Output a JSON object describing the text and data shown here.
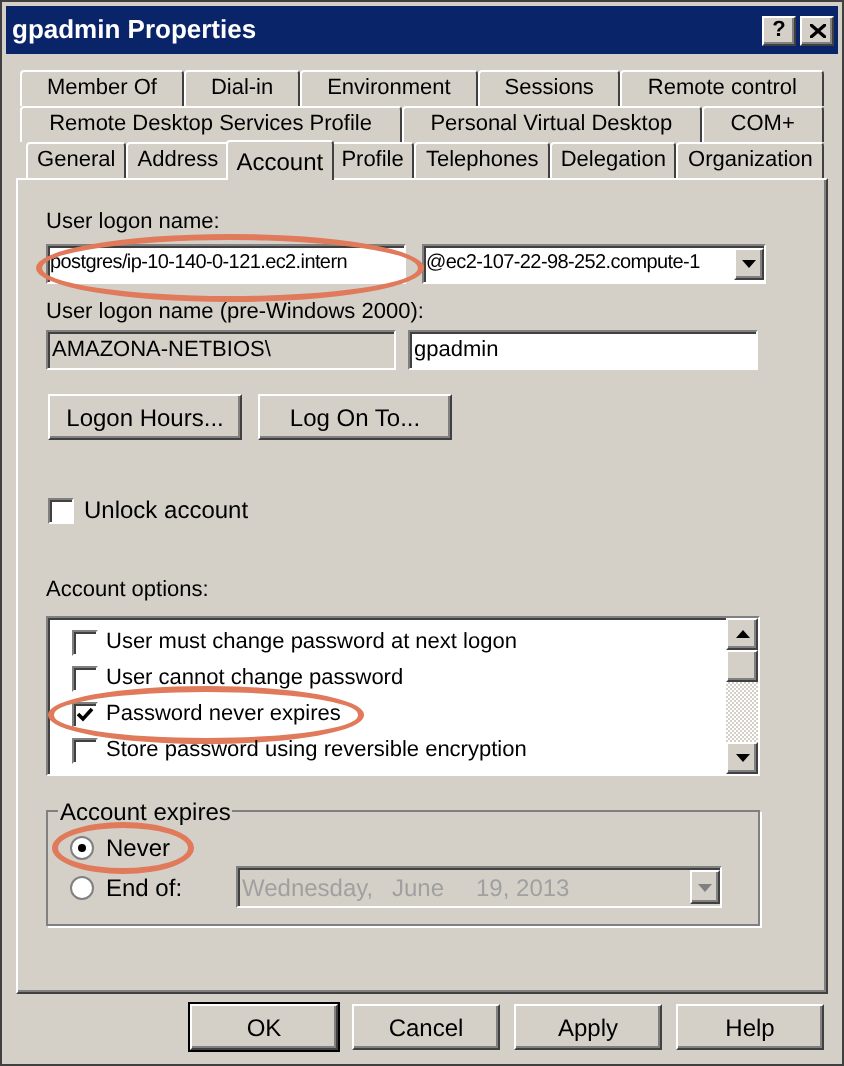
{
  "window": {
    "title": "gpadmin Properties",
    "help_button": "?"
  },
  "tabs": [
    [
      {
        "label": "Member Of",
        "selected": false
      },
      {
        "label": "Dial-in",
        "selected": false
      },
      {
        "label": "Environment",
        "selected": false
      },
      {
        "label": "Sessions",
        "selected": false
      },
      {
        "label": "Remote control",
        "selected": false
      }
    ],
    [
      {
        "label": "Remote Desktop Services Profile",
        "selected": false
      },
      {
        "label": "Personal Virtual Desktop",
        "selected": false
      },
      {
        "label": "COM+",
        "selected": false
      }
    ],
    [
      {
        "label": "General",
        "selected": false
      },
      {
        "label": "Address",
        "selected": false
      },
      {
        "label": "Account",
        "selected": true
      },
      {
        "label": "Profile",
        "selected": false
      },
      {
        "label": "Telephones",
        "selected": false
      },
      {
        "label": "Delegation",
        "selected": false
      },
      {
        "label": "Organization",
        "selected": false
      }
    ]
  ],
  "logon_name": {
    "label": "User logon name:",
    "value": "postgres/ip-10-140-0-121.ec2.intern",
    "domain": "@ec2-107-22-98-252.compute-1",
    "highlighted": true
  },
  "logon_name_pre2000": {
    "label": "User logon name (pre-Windows 2000):",
    "domain": "AMAZONA-NETBIOS\\",
    "value": "gpadmin"
  },
  "logon_buttons": [
    "Logon Hours...",
    "Log On To..."
  ],
  "unlock": {
    "label": "Unlock account",
    "checked": false
  },
  "account_options": {
    "label": "Account options:",
    "items": [
      {
        "label": "User must change password at next logon",
        "checked": false,
        "highlighted": false
      },
      {
        "label": "User cannot change password",
        "checked": false,
        "highlighted": false
      },
      {
        "label": "Password never expires",
        "checked": true,
        "highlighted": true
      },
      {
        "label": "Store password using reversible encryption",
        "checked": false,
        "highlighted": false
      }
    ]
  },
  "account_expires": {
    "label": "Account expires",
    "options": [
      {
        "label": "Never",
        "selected": true,
        "highlighted": true
      },
      {
        "label": "End of:",
        "selected": false,
        "highlighted": false
      }
    ],
    "date": {
      "weekday": "Wednesday,",
      "month": "June",
      "day_year": "19, 2013",
      "disabled": true
    }
  },
  "buttons": [
    {
      "label": "OK",
      "default": true
    },
    {
      "label": "Cancel",
      "default": false
    },
    {
      "label": "Apply",
      "default": false
    },
    {
      "label": "Help",
      "default": false
    }
  ]
}
